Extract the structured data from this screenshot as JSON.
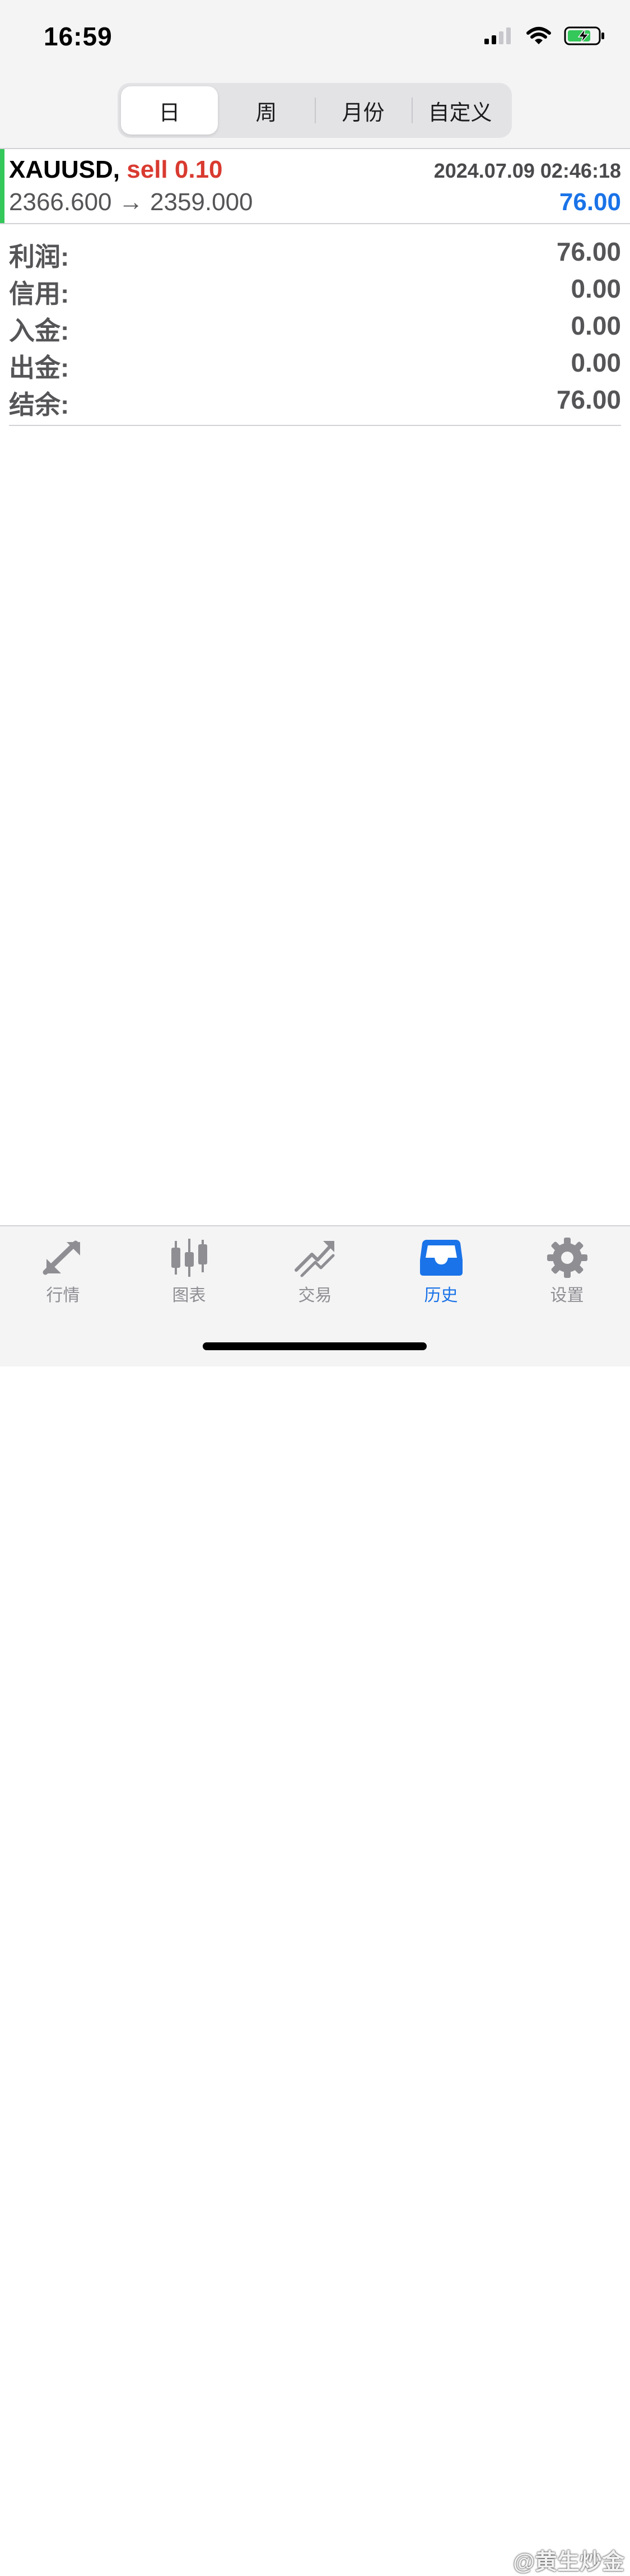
{
  "status_bar": {
    "time": "16:59"
  },
  "segmented": {
    "tabs": [
      "日",
      "周",
      "月份",
      "自定义"
    ],
    "active": "日"
  },
  "deal": {
    "symbol": "XAUUSD,",
    "type": "sell 0.10",
    "time": "2024.07.09 02:46:18",
    "open_price": "2366.600",
    "arrow": "→",
    "close_price": "2359.000",
    "profit": "76.00"
  },
  "summary": [
    {
      "label": "利润:",
      "value": "76.00"
    },
    {
      "label": "信用:",
      "value": "0.00"
    },
    {
      "label": "入金:",
      "value": "0.00"
    },
    {
      "label": "出金:",
      "value": "0.00"
    },
    {
      "label": "结余:",
      "value": "76.00"
    }
  ],
  "tabbar": {
    "items": [
      {
        "label": "行情",
        "icon": "quotes-arrow-icon"
      },
      {
        "label": "图表",
        "icon": "candlestick-icon"
      },
      {
        "label": "交易",
        "icon": "trade-trend-icon"
      },
      {
        "label": "历史",
        "icon": "history-tray-icon"
      },
      {
        "label": "设置",
        "icon": "gear-icon"
      }
    ],
    "active": "历史"
  },
  "watermark": "@黄生炒金",
  "colors": {
    "accent_blue": "#1a73e8",
    "sell_red": "#d93a30",
    "deal_accent_green": "#34c759",
    "inactive_gray": "#8e8e93"
  }
}
